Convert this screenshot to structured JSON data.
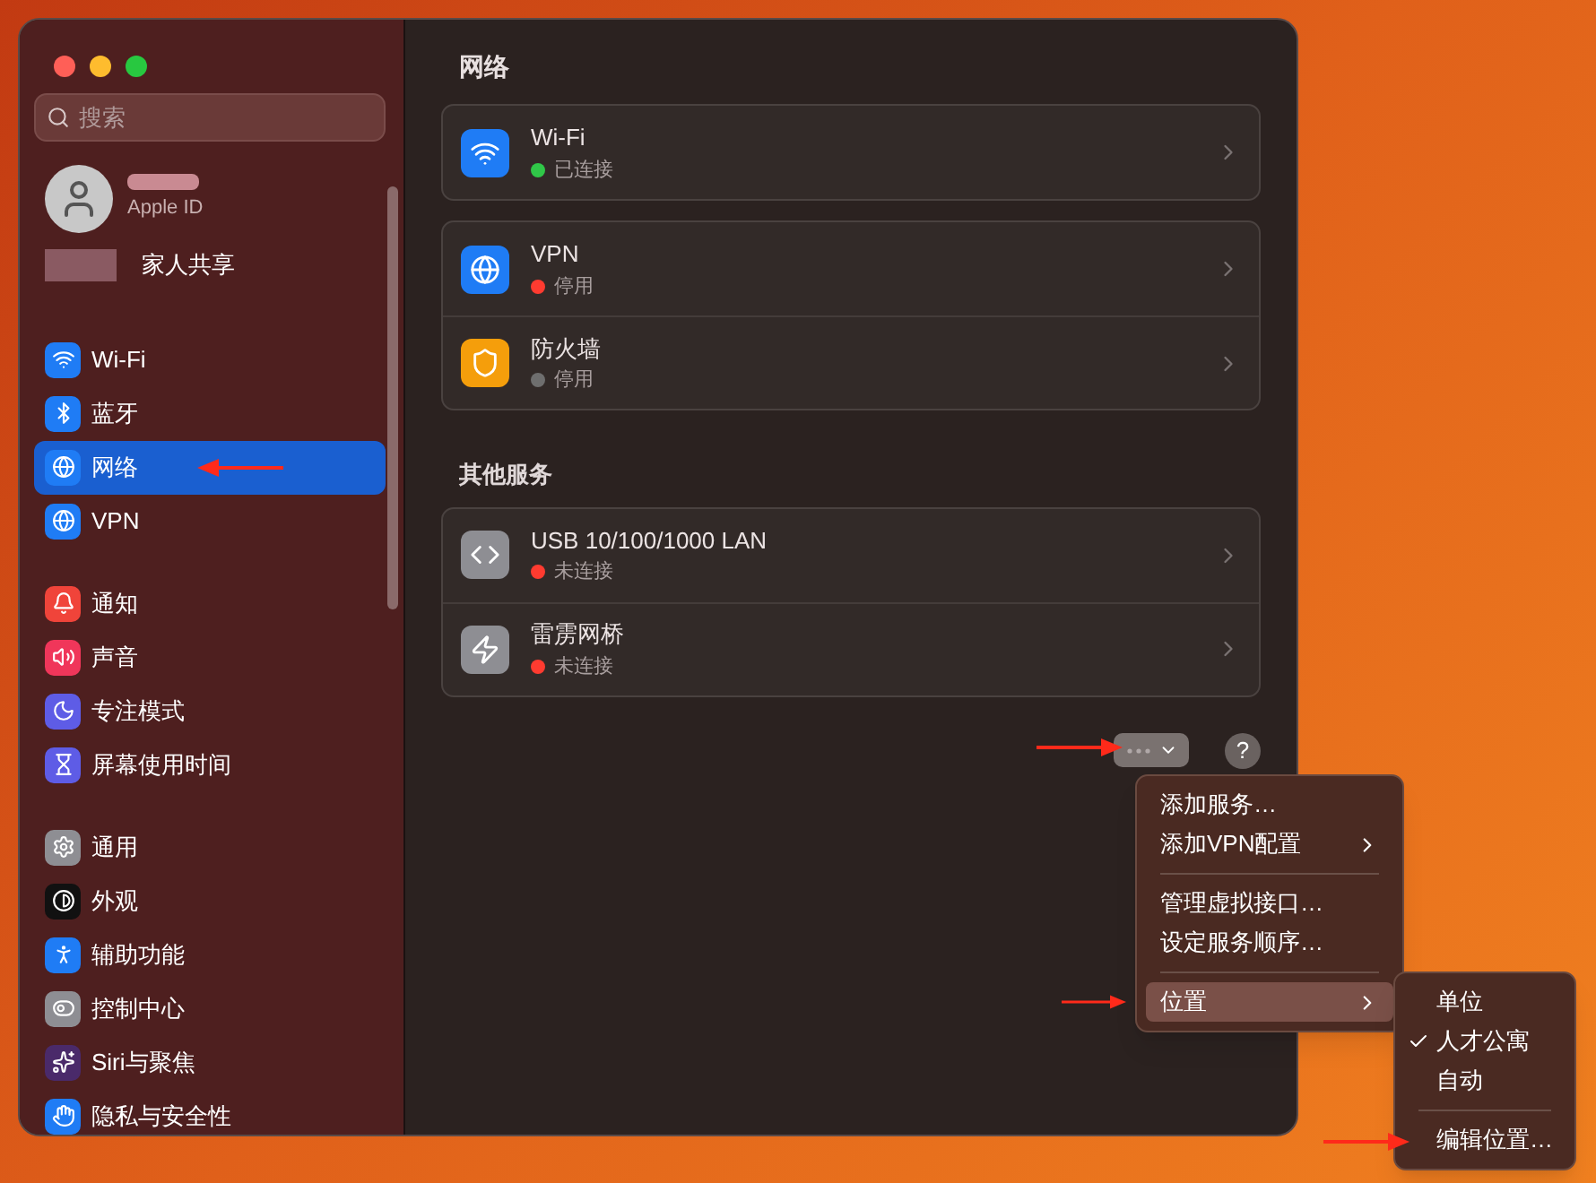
{
  "window": {
    "title": "网络"
  },
  "sidebar": {
    "search": {
      "placeholder": "搜索"
    },
    "account": {
      "subtitle": "Apple ID"
    },
    "family": {
      "label": "家人共享"
    },
    "groups": [
      [
        {
          "label": "Wi-Fi",
          "selected": false
        },
        {
          "label": "蓝牙",
          "selected": false
        },
        {
          "label": "网络",
          "selected": true
        },
        {
          "label": "VPN",
          "selected": false
        }
      ],
      [
        {
          "label": "通知",
          "selected": false
        },
        {
          "label": "声音",
          "selected": false
        },
        {
          "label": "专注模式",
          "selected": false
        },
        {
          "label": "屏幕使用时间",
          "selected": false
        }
      ],
      [
        {
          "label": "通用",
          "selected": false
        },
        {
          "label": "外观",
          "selected": false
        },
        {
          "label": "辅助功能",
          "selected": false
        },
        {
          "label": "控制中心",
          "selected": false
        },
        {
          "label": "Siri与聚焦",
          "selected": false
        },
        {
          "label": "隐私与安全性",
          "selected": false
        }
      ]
    ]
  },
  "sections": [
    {
      "cards": [
        [
          {
            "name": "Wi-Fi",
            "status": "已连接",
            "color": "#30c748"
          }
        ],
        [
          {
            "name": "VPN",
            "status": "停用",
            "color": "#ff3b30"
          },
          {
            "name": "防火墙",
            "status": "停用",
            "color": "#6e6e6e"
          }
        ]
      ]
    },
    {
      "heading": "其他服务",
      "cards": [
        [
          {
            "name": "USB 10/100/1000 LAN",
            "status": "未连接",
            "color": "#ff3b30"
          },
          {
            "name": "雷雳网桥",
            "status": "未连接",
            "color": "#ff3b30"
          }
        ]
      ]
    }
  ],
  "toolbar": {
    "help": "?"
  },
  "menu": {
    "items": [
      {
        "kind": "item",
        "label": "添加服务…",
        "selected": false
      },
      {
        "kind": "submenu",
        "label": "添加VPN配置",
        "selected": false
      },
      {
        "kind": "separator"
      },
      {
        "kind": "item",
        "label": "管理虚拟接口…",
        "selected": false
      },
      {
        "kind": "item",
        "label": "设定服务顺序…",
        "selected": false
      },
      {
        "kind": "separator"
      },
      {
        "kind": "submenu",
        "label": "位置",
        "selected": true
      }
    ]
  },
  "submenu": {
    "items": [
      {
        "kind": "item",
        "label": "单位",
        "checked": false
      },
      {
        "kind": "item",
        "label": "人才公寓",
        "checked": true
      },
      {
        "kind": "item",
        "label": "自动",
        "checked": false
      },
      {
        "kind": "separator"
      },
      {
        "kind": "item",
        "label": "编辑位置…",
        "checked": false
      }
    ]
  }
}
